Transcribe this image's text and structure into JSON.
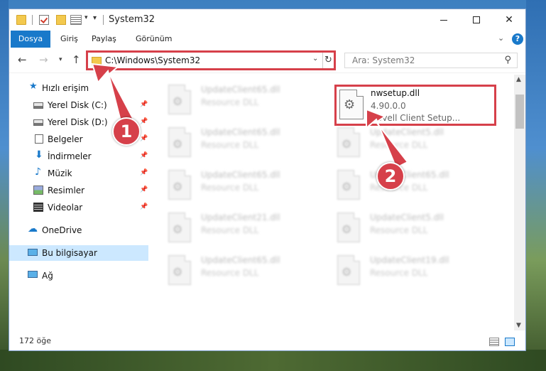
{
  "window": {
    "title": "System32"
  },
  "ribbon": {
    "tabs": [
      "Dosya",
      "Giriş",
      "Paylaş",
      "Görünüm"
    ],
    "help": "?"
  },
  "nav": {
    "address": "C:\\Windows\\System32",
    "search_placeholder": "Ara: System32"
  },
  "sidebar": {
    "items": [
      {
        "label": "Hızlı erişim",
        "icon": "star-icon"
      },
      {
        "label": "Yerel Disk (C:)",
        "icon": "drive-icon",
        "pinned": true
      },
      {
        "label": "Yerel Disk (D:)",
        "icon": "drive-icon",
        "pinned": true
      },
      {
        "label": "Belgeler",
        "icon": "documents-icon",
        "pinned": true
      },
      {
        "label": "İndirmeler",
        "icon": "download-icon",
        "pinned": true
      },
      {
        "label": "Müzik",
        "icon": "music-icon",
        "pinned": true
      },
      {
        "label": "Resimler",
        "icon": "pictures-icon",
        "pinned": true
      },
      {
        "label": "Videolar",
        "icon": "videos-icon",
        "pinned": true
      },
      {
        "label": "OneDrive",
        "icon": "onedrive-icon"
      },
      {
        "label": "Bu bilgisayar",
        "icon": "this-pc-icon",
        "selected": true
      },
      {
        "label": "Ağ",
        "icon": "network-icon"
      }
    ]
  },
  "files": {
    "highlighted": {
      "name": "nwsetup.dll",
      "version": "4.90.0.0",
      "description": "Novell Client Setup..."
    },
    "blurred": [
      {
        "name": "UpdateClient65.dll",
        "desc": "Resource DLL"
      },
      {
        "name": "UpdateClient65.dll",
        "desc": "Resource DLL"
      },
      {
        "name": "UpdateClient5.dll",
        "desc": "Resource DLL"
      },
      {
        "name": "UpdateClient65.dll",
        "desc": "Resource DLL"
      },
      {
        "name": "UpdateClient65.dll",
        "desc": "Resource DLL"
      },
      {
        "name": "UpdateClient21.dll",
        "desc": "Resource DLL"
      },
      {
        "name": "UpdateClient5.dll",
        "desc": "Resource DLL"
      },
      {
        "name": "UpdateClient65.dll",
        "desc": "Resource DLL"
      },
      {
        "name": "UpdateClient19.dll",
        "desc": "Resource DLL"
      }
    ]
  },
  "status": {
    "count": "172 öğe"
  },
  "annotations": {
    "step1": "1",
    "step2": "2"
  },
  "colors": {
    "accent": "#1979ca",
    "annotation_red": "#d6404a",
    "selected_bg": "#cce8ff"
  }
}
